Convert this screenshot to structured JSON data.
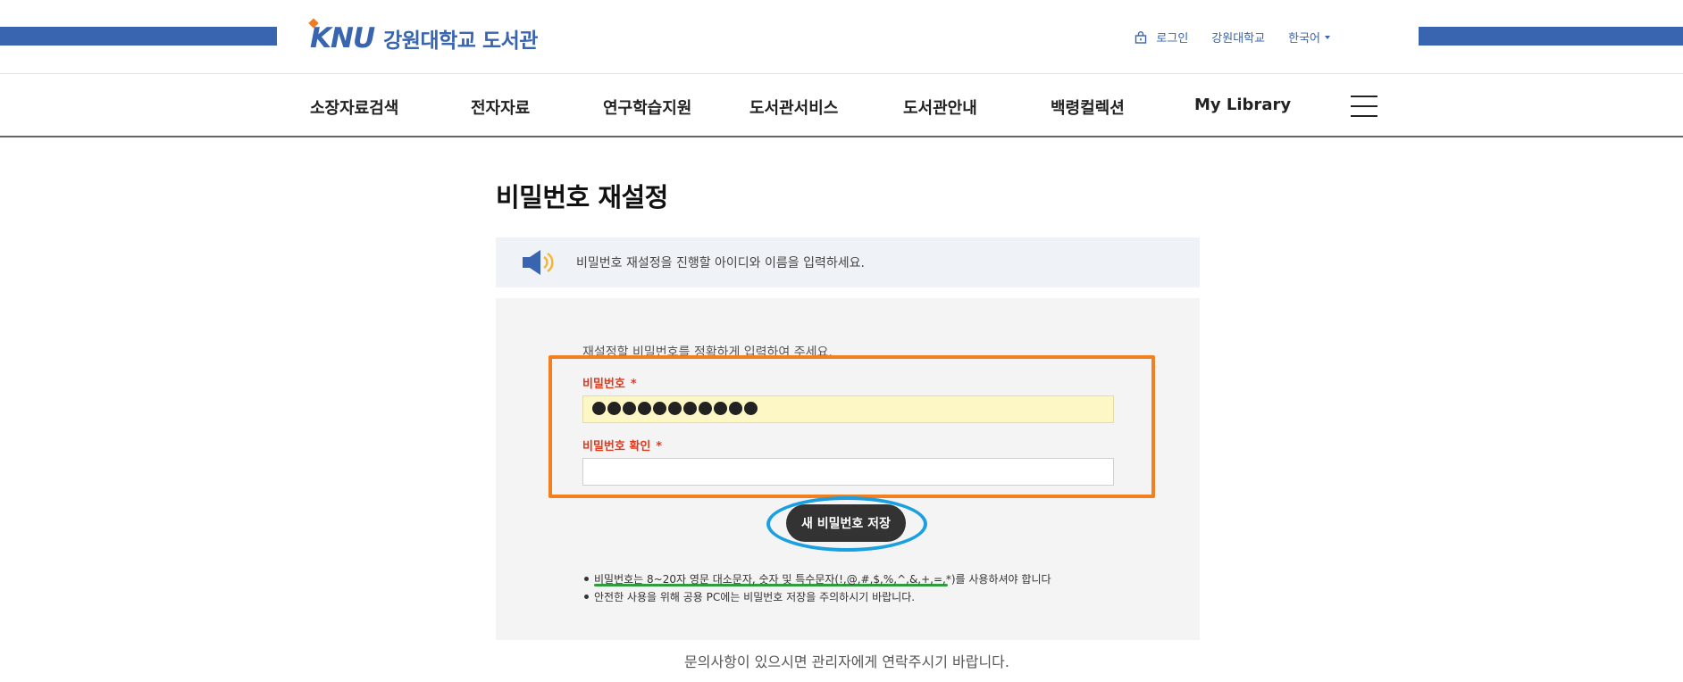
{
  "header": {
    "logo_mark": "KNU",
    "logo_text": "강원대학교 도서관",
    "utility": {
      "login": "로그인",
      "university": "강원대학교",
      "language": "한국어"
    }
  },
  "nav": {
    "items": [
      {
        "label": "소장자료검색"
      },
      {
        "label": "전자자료"
      },
      {
        "label": "연구학습지원"
      },
      {
        "label": "도서관서비스"
      },
      {
        "label": "도서관안내"
      },
      {
        "label": "백령컬렉션"
      },
      {
        "label": "My Library"
      }
    ]
  },
  "main": {
    "title": "비밀번호 재설정",
    "notice": "비밀번호 재설정을 진행할 아이디와 이름을 입력하세요.",
    "panel": {
      "intro": "재설정할 비밀번호를 정확하게 입력하여 주세요.",
      "password_label": "비밀번호",
      "confirm_label": "비밀번호 확인",
      "required_mark": "*",
      "password_masked_length": 11,
      "confirm_value": "",
      "save_button": "새 비밀번호 저장",
      "rules": [
        "비밀번호는 8~20자 영문 대소문자, 숫자 및 특수문자(!,@,#,$,%,^,&,+,=,*)를 사용하셔야 합니다",
        "안전한 사용을 위해 공용 PC에는 비밀번호 저장을 주의하시기 바랍니다."
      ]
    },
    "footer_note": "문의사항이 있으시면 관리자에게 연락주시기 바랍니다."
  },
  "colors": {
    "brand_blue": "#3864b0",
    "accent_orange": "#f07c22",
    "required_red": "#e03a1f",
    "highlight_box": "#f28021",
    "highlight_circle": "#1a9fe0",
    "highlight_underline": "#2e9e3c",
    "filled_input": "#fdf7c5"
  },
  "icons": {
    "login": "lock-icon",
    "notice": "speaker-icon",
    "menu": "hamburger-icon"
  }
}
